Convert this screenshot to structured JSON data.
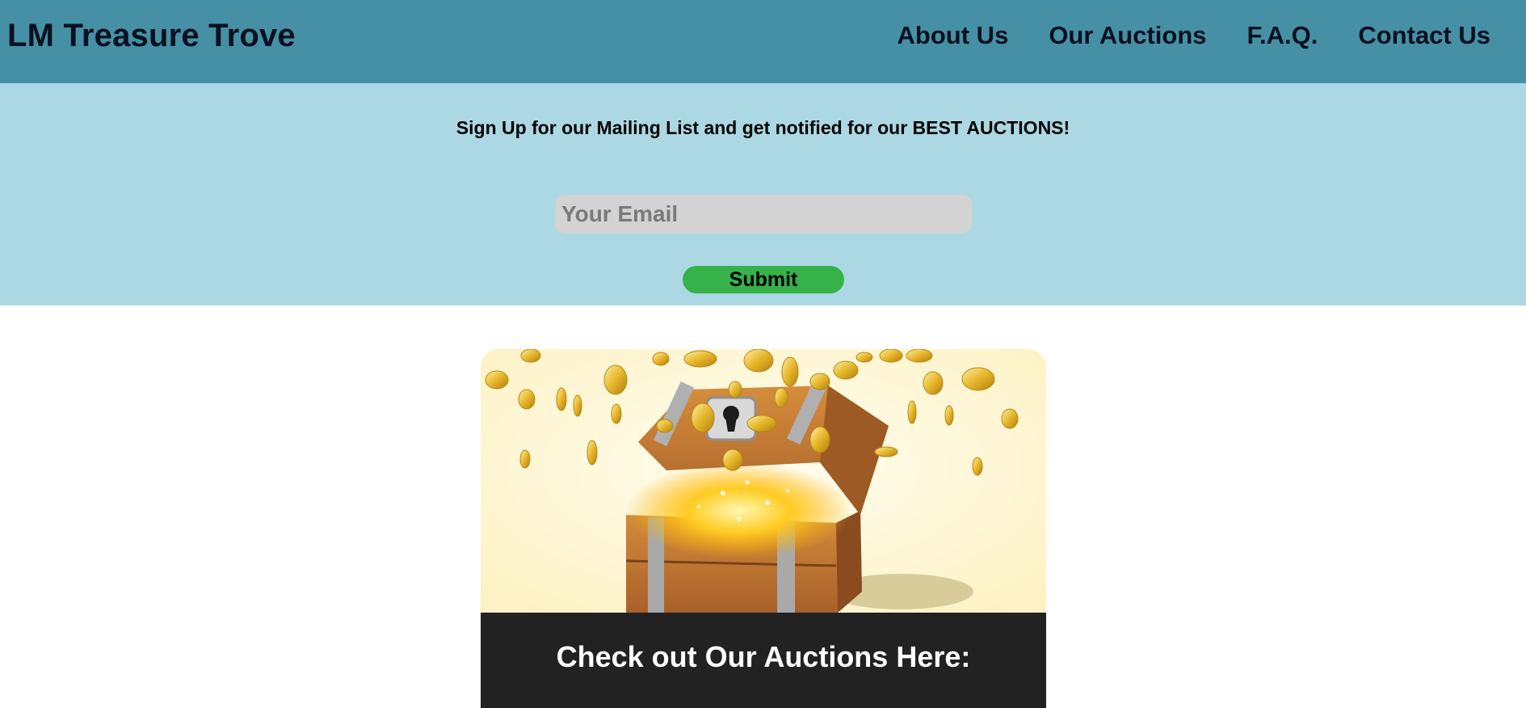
{
  "header": {
    "brand": "LM Treasure Trove",
    "nav": [
      "About Us",
      "Our Auctions",
      "F.A.Q.",
      "Contact Us"
    ]
  },
  "signup": {
    "message": "Sign Up for our Mailing List and get notified for our BEST AUCTIONS!",
    "email_placeholder": "Your Email",
    "email_value": "",
    "submit_label": "Submit"
  },
  "feature_card": {
    "image_icon": "treasure-chest-image",
    "caption": "Check out Our Auctions Here:"
  },
  "colors": {
    "header_bg": "#4590a4",
    "signup_bg": "#acd8e4",
    "submit_bg": "#35b24a",
    "caption_bg": "#222222"
  }
}
